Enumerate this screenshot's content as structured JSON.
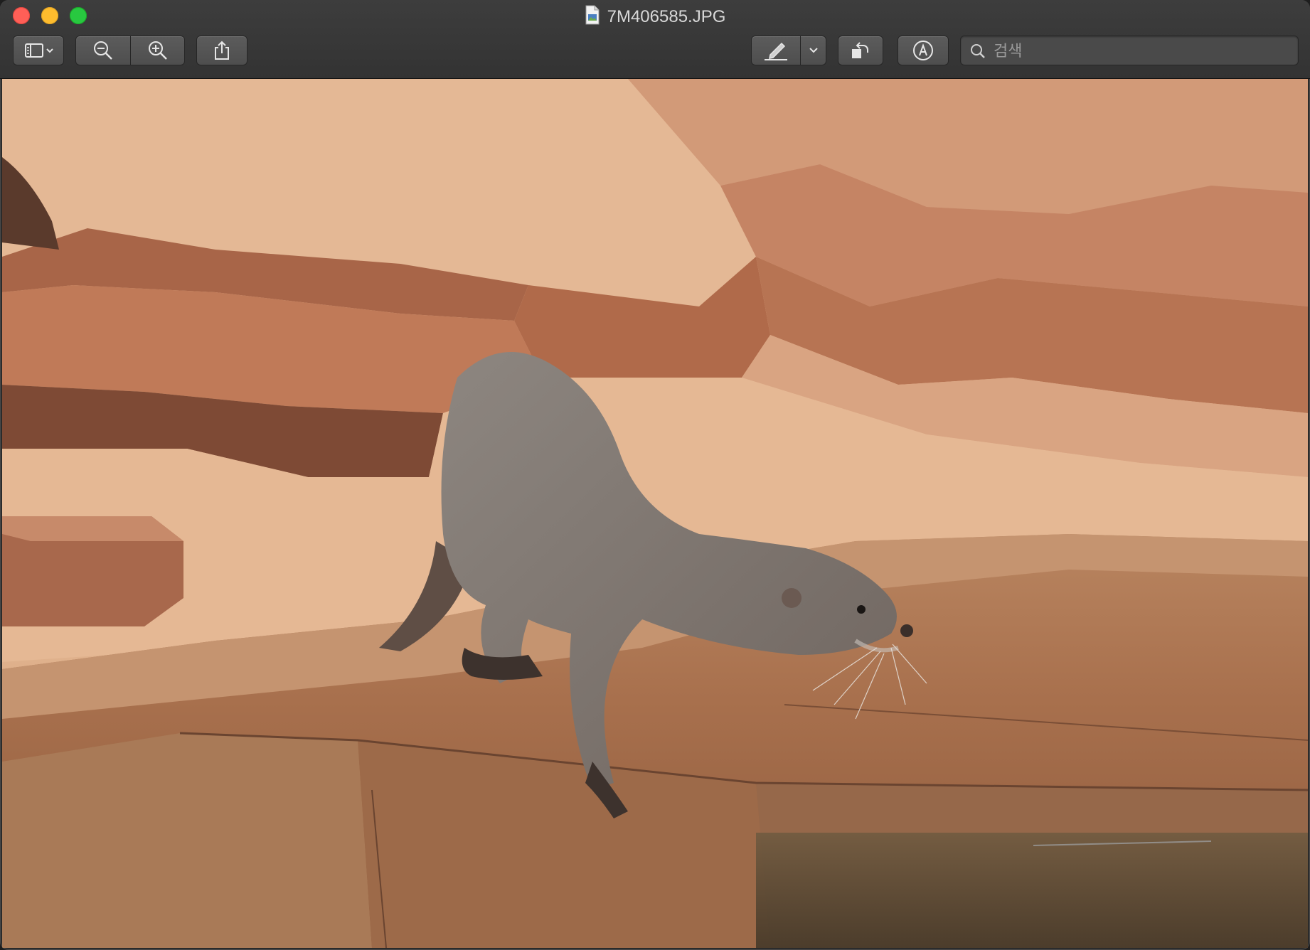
{
  "window": {
    "title": "7M406585.JPG",
    "traffic_lights": {
      "close": "#ff5f57",
      "minimize": "#febc2e",
      "maximize": "#28c840"
    }
  },
  "toolbar": {
    "sidebar_icon": "sidebar-icon",
    "zoom_out_icon": "zoom-out-icon",
    "zoom_in_icon": "zoom-in-icon",
    "share_icon": "share-icon",
    "markup_icon": "pen-icon",
    "rotate_icon": "rotate-left-icon",
    "annotate_icon": "markup-circle-icon",
    "search_placeholder": "검색"
  },
  "image": {
    "subject_colors": {
      "rock": "#b07a55",
      "background": "#d9a882",
      "otter": "#7f7670"
    }
  }
}
